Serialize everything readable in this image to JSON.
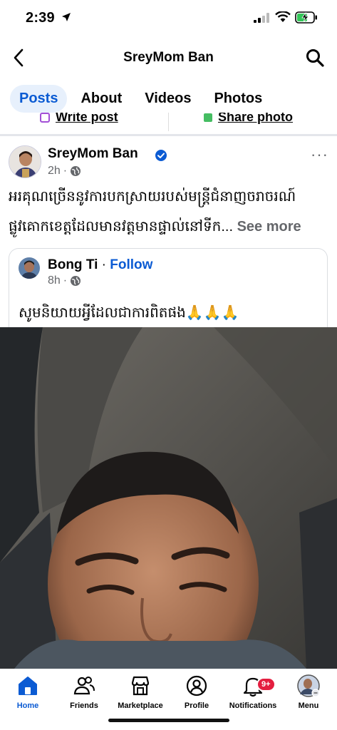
{
  "status_bar": {
    "time": "2:39",
    "icons": [
      "location-arrow-icon",
      "cellular-signal-icon",
      "wifi-icon",
      "battery-charging-icon"
    ]
  },
  "header": {
    "title": "SreyMom Ban",
    "back_icon": "chevron-left-icon",
    "search_icon": "search-icon"
  },
  "tabs": [
    {
      "label": "Posts",
      "active": true
    },
    {
      "label": "About",
      "active": false
    },
    {
      "label": "Videos",
      "active": false
    },
    {
      "label": "Photos",
      "active": false
    }
  ],
  "composer": {
    "write_post": "Write post",
    "share_photo": "Share photo"
  },
  "post": {
    "author": "SreyMom Ban",
    "time": "2h",
    "separator": "·",
    "more": "···",
    "text_line1": "អរគុណច្រើននូវការបកស្រាយរបស់មន្ត្រីជំនាញចរាចរណ៍",
    "text_line2": "ផ្លូវគោកខេត្តដែលមានវត្តមានផ្ទាល់នៅទីក...",
    "see_more": "See more",
    "shared": {
      "author": "Bong Ti",
      "separator": "·",
      "follow": "Follow",
      "time": "8h",
      "text": "សូមនិយាយអ្វីដែលជាការពិតផង🙏🙏🙏"
    }
  },
  "bottom_nav": [
    {
      "label": "Home",
      "icon": "home-icon",
      "active": true
    },
    {
      "label": "Friends",
      "icon": "friends-icon",
      "active": false
    },
    {
      "label": "Marketplace",
      "icon": "marketplace-icon",
      "active": false
    },
    {
      "label": "Profile",
      "icon": "profile-icon",
      "active": false
    },
    {
      "label": "Notifications",
      "icon": "bell-icon",
      "active": false,
      "badge": "9+"
    },
    {
      "label": "Menu",
      "icon": "menu-avatar-icon",
      "active": false
    }
  ],
  "colors": {
    "accent": "#0b5bd3",
    "active_tab_bg": "#e7f0fc",
    "badge": "#e41e3f",
    "secondary_text": "#65676b"
  }
}
